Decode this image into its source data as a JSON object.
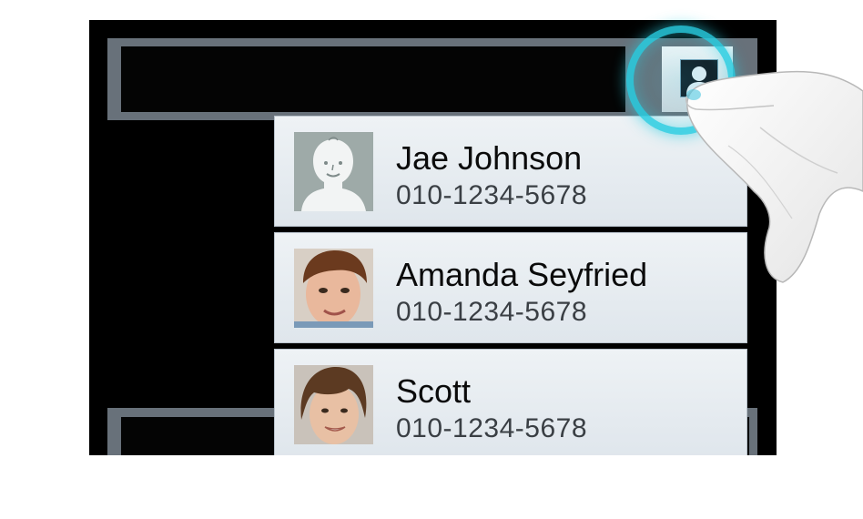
{
  "contacts": [
    {
      "name": "Jae Johnson",
      "phone": "010-1234-5678",
      "photo": "default-avatar"
    },
    {
      "name": "Amanda Seyfried",
      "phone": "010-1234-5678",
      "photo": "child-portrait"
    },
    {
      "name": "Scott",
      "phone": "010-1234-5678",
      "photo": "teen-portrait"
    }
  ],
  "toolbar": {
    "contact_button_icon": "contact-person-icon"
  },
  "colors": {
    "bar": "#68717a",
    "screen": "#000000",
    "card": "#e7ecf0",
    "touch_ring": "#28cde1"
  }
}
